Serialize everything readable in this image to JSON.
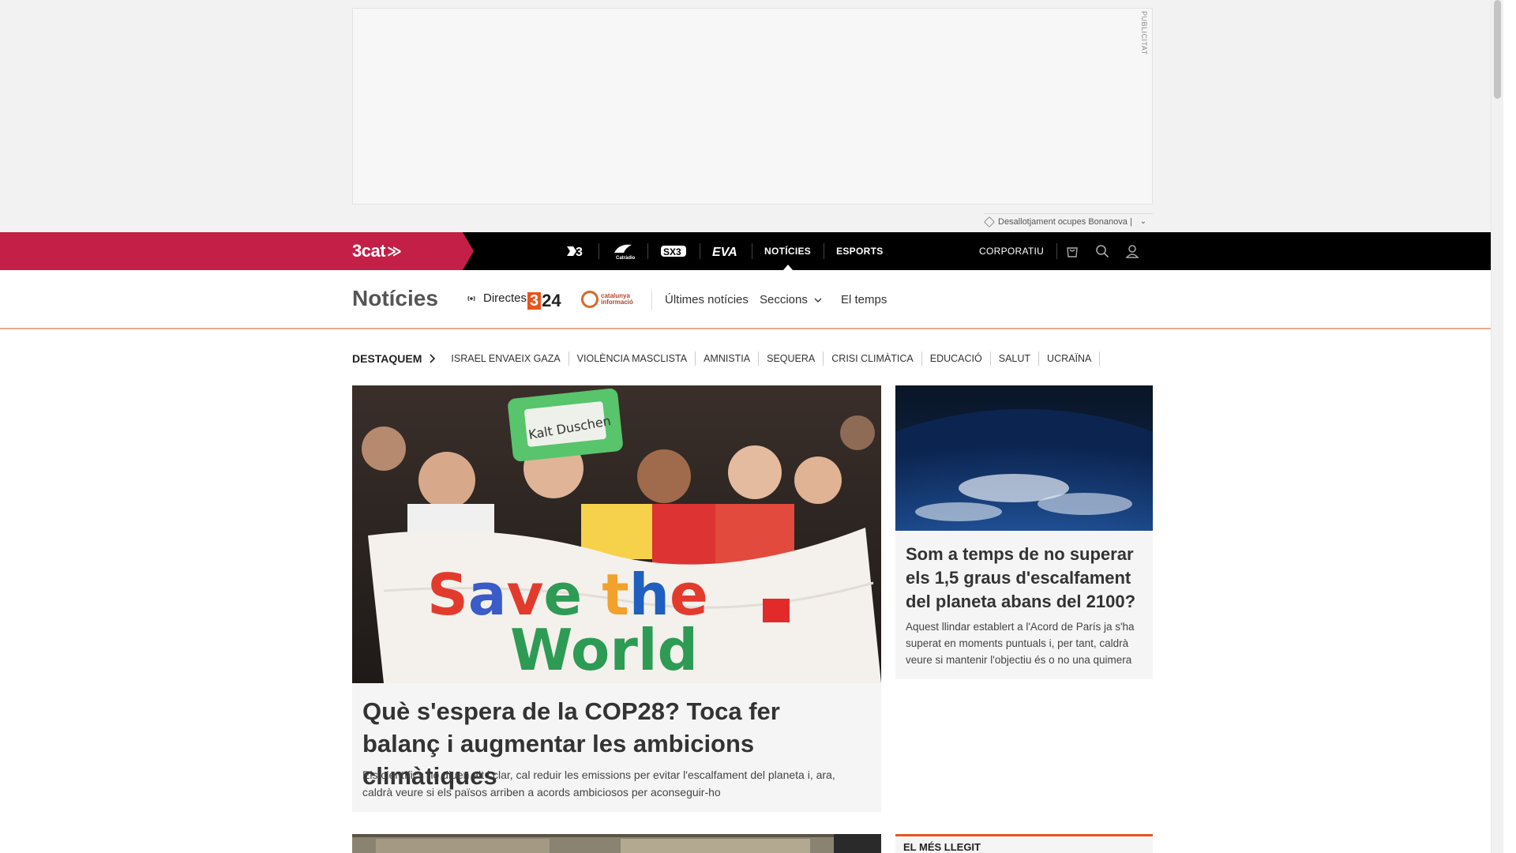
{
  "ad": {
    "label": "PUBLICITAT",
    "sponsor_text": "Desallotjament ocupes Bonanova |"
  },
  "topbar": {
    "brand": "3cat",
    "channels": [
      {
        "label": "3",
        "name": "channel-tv3"
      },
      {
        "label": "CR",
        "name": "channel-catradio"
      },
      {
        "label": "SX3",
        "name": "channel-sx3"
      },
      {
        "label": "EVA",
        "name": "channel-eva"
      },
      {
        "label": "NOTÍCIES",
        "name": "channel-noticies"
      },
      {
        "label": "ESPORTS",
        "name": "channel-esports"
      }
    ],
    "corporatiu": "CORPORATIU"
  },
  "secnav": {
    "title": "Notícies",
    "live": "Directes",
    "logo_324_three": "3",
    "logo_324_rest": "24",
    "logo_ci_line1": "catalunya",
    "logo_ci_line2": "informació",
    "ultimes": "Últimes notícies",
    "seccions": "Seccions",
    "temps": "El temps"
  },
  "destaquem": {
    "label": "DESTAQUEM",
    "items": [
      "ISRAEL ENVAEIX GAZA",
      "VIOLÈNCIA MASCLISTA",
      "AMNISTIA",
      "SEQUERA",
      "CRISI CLIMÀTICA",
      "EDUCACIÓ",
      "SALUT",
      "UCRAÏNA"
    ]
  },
  "main_article": {
    "title": "Què s'espera de la COP28? Toca fer balanç i augmentar les ambicions climàtiques",
    "summary": "Els científics ho diuen alt i clar, cal reduir les emissions per evitar l'escalfament del planeta i, ara, caldrà veure si els països arriben a acords ambiciosos per aconseguir-ho",
    "banner_text_1": "Save the",
    "banner_text_2": "World",
    "sign_text": "Kalt Duschen"
  },
  "side_article": {
    "title": "Som a temps de no superar els 1,5 graus d'escalfament del planeta abans del 2100?",
    "summary": "Aquest llindar establert a l'Acord de París ja s'ha superat en moments puntuals i, per tant, caldrà veure si mantenir l'objectiu és o no una quimera"
  },
  "mes_llegit": {
    "title": "EL MÉS LLEGIT"
  },
  "colors": {
    "brand": "#c41f46",
    "accent": "#e8551c",
    "topbar": "#000000"
  }
}
